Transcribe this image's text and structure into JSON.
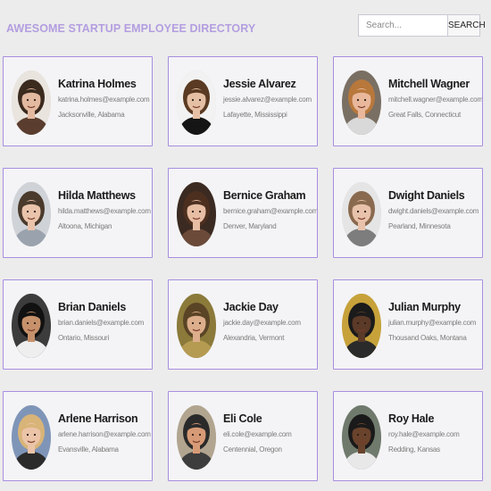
{
  "header": {
    "title": "AWESOME STARTUP EMPLOYEE DIRECTORY",
    "search": {
      "placeholder": "Search...",
      "value": "",
      "button_label": "SEARCH",
      "icon": "search-icon"
    }
  },
  "colors": {
    "accent": "#b39ee0",
    "card_border": "#a88ee0",
    "card_bg": "#f4f4f6",
    "page_bg": "#ececec"
  },
  "employees": [
    {
      "name": "Katrina Holmes",
      "email": "katrina.holmes@example.com",
      "location": "Jacksonville, Alabama",
      "photo": {
        "bg": "#e9e4de",
        "hair": "#3b2a1e",
        "skin": "#e3b9a0",
        "shirt": "#5a3d2e"
      }
    },
    {
      "name": "Jessie Alvarez",
      "email": "jessie.alvarez@example.com",
      "location": "Lafayette, Mississippi",
      "photo": {
        "bg": "#f2f2f2",
        "hair": "#5a3a22",
        "skin": "#e6c0a5",
        "shirt": "#151515"
      }
    },
    {
      "name": "Mitchell Wagner",
      "email": "mitchell.wagner@example.com",
      "location": "Great Falls, Connecticut",
      "photo": {
        "bg": "#7a6f63",
        "hair": "#b8783c",
        "skin": "#e9b89c",
        "shirt": "#d9d9d9"
      }
    },
    {
      "name": "Hilda Matthews",
      "email": "hilda.matthews@example.com",
      "location": "Altoona, Michigan",
      "photo": {
        "bg": "#cfd3d8",
        "hair": "#4a3a2c",
        "skin": "#eac3ab",
        "shirt": "#9aa3ad"
      }
    },
    {
      "name": "Bernice Graham",
      "email": "bernice.graham@example.com",
      "location": "Denver, Maryland",
      "photo": {
        "bg": "#3a2a22",
        "hair": "#4d2f1f",
        "skin": "#e7bda3",
        "shirt": "#6b4a3a"
      }
    },
    {
      "name": "Dwight Daniels",
      "email": "dwight.daniels@example.com",
      "location": "Pearland, Minnesota",
      "photo": {
        "bg": "#e5e5e5",
        "hair": "#8a6a4e",
        "skin": "#e8c2aa",
        "shirt": "#7d7d7d"
      }
    },
    {
      "name": "Brian Daniels",
      "email": "brian.daniels@example.com",
      "location": "Ontario, Missouri",
      "photo": {
        "bg": "#3c3c3c",
        "hair": "#111111",
        "skin": "#c6916b",
        "shirt": "#eeeeee"
      }
    },
    {
      "name": "Jackie Day",
      "email": "jackie.day@example.com",
      "location": "Alexandria, Vermont",
      "photo": {
        "bg": "#8b7a3a",
        "hair": "#5a4426",
        "skin": "#dcae8c",
        "shirt": "#b59b52"
      }
    },
    {
      "name": "Julian Murphy",
      "email": "julian.murphy@example.com",
      "location": "Thousand Oaks, Montana",
      "photo": {
        "bg": "#c7a23a",
        "hair": "#1b1b1b",
        "skin": "#5b3a28",
        "shirt": "#2a2a2a"
      }
    },
    {
      "name": "Arlene Harrison",
      "email": "arlene.harrison@example.com",
      "location": "Evansville, Alabama",
      "photo": {
        "bg": "#7f95b8",
        "hair": "#d8b478",
        "skin": "#ebc4a8",
        "shirt": "#2b2b2b"
      }
    },
    {
      "name": "Eli Cole",
      "email": "eli.cole@example.com",
      "location": "Centennial, Oregon",
      "photo": {
        "bg": "#b2a590",
        "hair": "#2a2a2a",
        "skin": "#d79a76",
        "shirt": "#3d3d3d"
      }
    },
    {
      "name": "Roy Hale",
      "email": "roy.hale@example.com",
      "location": "Redding, Kansas",
      "photo": {
        "bg": "#6f7a6c",
        "hair": "#1a1a1a",
        "skin": "#6a432c",
        "shirt": "#e8e8e8"
      }
    }
  ]
}
